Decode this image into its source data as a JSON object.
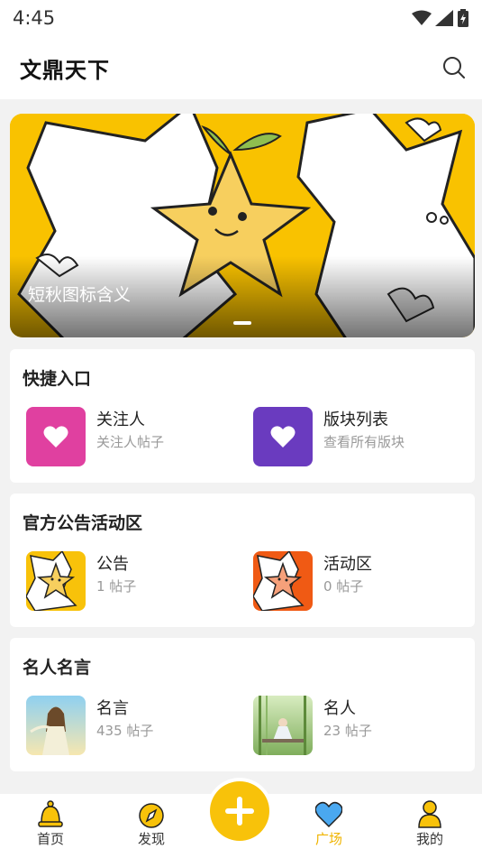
{
  "status_bar": {
    "time": "4:45"
  },
  "header": {
    "title": "文鼎天下",
    "search_icon": "search-icon"
  },
  "banner": {
    "caption": "短秋图标含义"
  },
  "quick_entry": {
    "title": "快捷入口",
    "items": [
      {
        "name": "关注人",
        "sub": "关注人帖子",
        "color": "#e040a0",
        "icon": "heart-icon"
      },
      {
        "name": "版块列表",
        "sub": "查看所有版块",
        "color": "#6a3bbf",
        "icon": "heart-icon"
      }
    ]
  },
  "announcement": {
    "title": "官方公告活动区",
    "items": [
      {
        "name": "公告",
        "sub": "1 帖子",
        "color": "#f8c20a"
      },
      {
        "name": "活动区",
        "sub": "0 帖子",
        "color": "#f05a14"
      }
    ]
  },
  "quotes": {
    "title": "名人名言",
    "items": [
      {
        "name": "名言",
        "sub": "435 帖子"
      },
      {
        "name": "名人",
        "sub": "23 帖子"
      }
    ]
  },
  "tabbar": {
    "items": [
      {
        "label": "首页",
        "icon": "bell-icon"
      },
      {
        "label": "发现",
        "icon": "compass-icon"
      },
      {
        "label": "广场",
        "icon": "heart-icon",
        "active": true
      },
      {
        "label": "我的",
        "icon": "person-icon"
      }
    ],
    "accent": "#f0b400"
  }
}
